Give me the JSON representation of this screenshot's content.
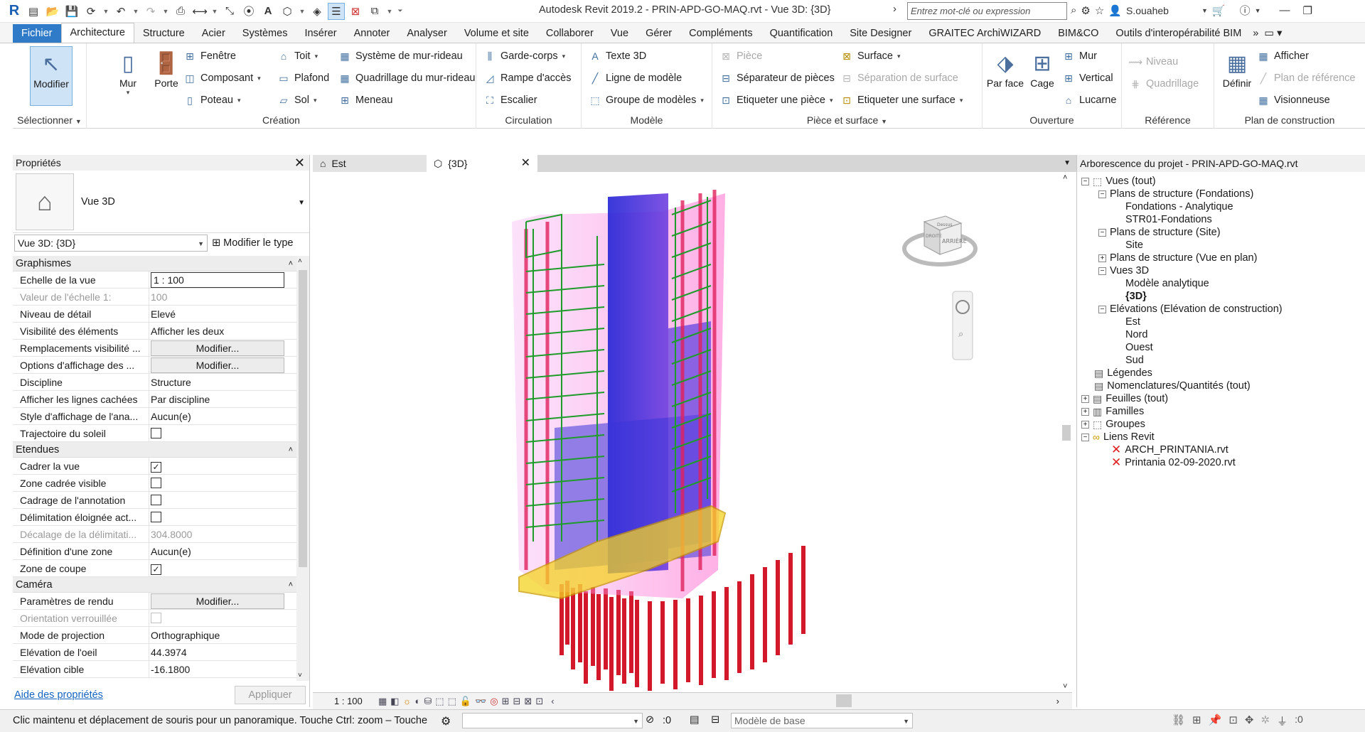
{
  "titlebar": {
    "title": "Autodesk Revit 2019.2 - PRIN-APD-GO-MAQ.rvt - Vue 3D: {3D}",
    "search_placeholder": "Entrez mot-clé ou expression",
    "user": "S.ouaheb"
  },
  "tabs": [
    "Fichier",
    "Architecture",
    "Structure",
    "Acier",
    "Systèmes",
    "Insérer",
    "Annoter",
    "Analyser",
    "Volume et site",
    "Collaborer",
    "Vue",
    "Gérer",
    "Compléments",
    "Quantification",
    "Site Designer",
    "GRAITEC ArchiWIZARD",
    "BIM&CO",
    "Outils d'interopérabilité BIM"
  ],
  "ribbon": {
    "select": {
      "button": "Modifier",
      "label": "Sélectionner"
    },
    "creation": {
      "label": "Création",
      "wall": "Mur",
      "door": "Porte",
      "window": "Fenêtre",
      "component": "Composant",
      "column": "Poteau",
      "roof": "Toit",
      "ceiling": "Plafond",
      "floor": "Sol",
      "curtain_system": "Système de mur-rideau",
      "curtain_grid": "Quadrillage du mur-rideau",
      "mullion": "Meneau"
    },
    "circulation": {
      "label": "Circulation",
      "railing": "Garde-corps",
      "ramp": "Rampe d'accès",
      "stair": "Escalier"
    },
    "model": {
      "label": "Modèle",
      "text": "Texte 3D",
      "line": "Ligne de modèle",
      "group": "Groupe de modèles"
    },
    "room": {
      "label": "Pièce et surface",
      "room": "Pièce",
      "separator": "Séparateur de pièces",
      "tag_room": "Etiqueter une pièce",
      "area": "Surface",
      "area_boundary": "Séparation de surface",
      "tag_area": "Etiqueter une surface"
    },
    "opening": {
      "label": "Ouverture",
      "by_face": "Par face",
      "shaft": "Cage",
      "wall": "Mur",
      "vertical": "Vertical",
      "dormer": "Lucarne"
    },
    "datum": {
      "label": "Référence",
      "level": "Niveau",
      "grid": "Quadrillage"
    },
    "workplane": {
      "label": "Plan de construction",
      "set": "Définir",
      "show": "Afficher",
      "ref_plane": "Plan de référence",
      "viewer": "Visionneuse"
    }
  },
  "properties": {
    "header": "Propriétés",
    "type_name": "Vue 3D",
    "selector": "Vue 3D: {3D}",
    "edit_type": "Modifier le type",
    "sections": {
      "graphics": "Graphismes",
      "extents": "Etendues",
      "camera": "Caméra"
    },
    "graphics_rows": [
      {
        "name": "Echelle de la vue",
        "value": "1 : 100"
      },
      {
        "name": "Valeur de l'échelle    1:",
        "value": "100"
      },
      {
        "name": "Niveau de détail",
        "value": "Elevé"
      },
      {
        "name": "Visibilité des éléments",
        "value": "Afficher les deux"
      },
      {
        "name": "Remplacements visibilité ...",
        "value": "Modifier..."
      },
      {
        "name": "Options d'affichage des ...",
        "value": "Modifier..."
      },
      {
        "name": "Discipline",
        "value": "Structure"
      },
      {
        "name": "Afficher les lignes cachées",
        "value": "Par discipline"
      },
      {
        "name": "Style d'affichage de l'ana...",
        "value": "Aucun(e)"
      },
      {
        "name": "Trajectoire du soleil",
        "value": ""
      }
    ],
    "extents_rows": [
      {
        "name": "Cadrer la vue",
        "value": "✓"
      },
      {
        "name": "Zone cadrée visible",
        "value": ""
      },
      {
        "name": "Cadrage de l'annotation",
        "value": ""
      },
      {
        "name": "Délimitation éloignée act...",
        "value": ""
      },
      {
        "name": "Décalage de la délimitati...",
        "value": "304.8000"
      },
      {
        "name": "Définition d'une zone",
        "value": "Aucun(e)"
      },
      {
        "name": "Zone de coupe",
        "value": "✓"
      }
    ],
    "camera_rows": [
      {
        "name": "Paramètres de rendu",
        "value": "Modifier..."
      },
      {
        "name": "Orientation verrouillée",
        "value": ""
      },
      {
        "name": "Mode de projection",
        "value": "Orthographique"
      },
      {
        "name": "Elévation de l'oeil",
        "value": "44.3974"
      },
      {
        "name": "Elévation cible",
        "value": "-16.1800"
      }
    ],
    "help_link": "Aide des propriétés",
    "apply": "Appliquer"
  },
  "view": {
    "tabs": [
      {
        "label": "Est"
      },
      {
        "label": "{3D}"
      }
    ],
    "scale": "1 : 100",
    "viewcube_top": "Dessus",
    "viewcube_front": "ARRIÈRE",
    "viewcube_side": "DROITE"
  },
  "browser": {
    "header": "Arborescence du projet - PRIN-APD-GO-MAQ.rvt",
    "items": [
      {
        "label": "Vues (tout)"
      },
      {
        "label": "Plans de structure (Fondations)"
      },
      {
        "label": "Fondations - Analytique"
      },
      {
        "label": "STR01-Fondations"
      },
      {
        "label": "Plans de structure (Site)"
      },
      {
        "label": "Site"
      },
      {
        "label": "Plans de structure (Vue en plan)"
      },
      {
        "label": "Vues 3D"
      },
      {
        "label": "Modèle analytique"
      },
      {
        "label": "{3D}"
      },
      {
        "label": "Elévations (Elévation de construction)"
      },
      {
        "label": "Est"
      },
      {
        "label": "Nord"
      },
      {
        "label": "Ouest"
      },
      {
        "label": "Sud"
      },
      {
        "label": "Légendes"
      },
      {
        "label": "Nomenclatures/Quantités (tout)"
      },
      {
        "label": "Feuilles (tout)"
      },
      {
        "label": "Familles"
      },
      {
        "label": "Groupes"
      },
      {
        "label": "Liens Revit"
      },
      {
        "label": "ARCH_PRINTANIA.rvt"
      },
      {
        "label": "Printania 02-09-2020.rvt"
      }
    ]
  },
  "status": {
    "message": "Clic maintenu et déplacement de souris pour un panoramique. Touche Ctrl: zoom – Touche",
    "workset_count": ":0",
    "design_option": "Modèle de base",
    "filter_count": ":0"
  }
}
